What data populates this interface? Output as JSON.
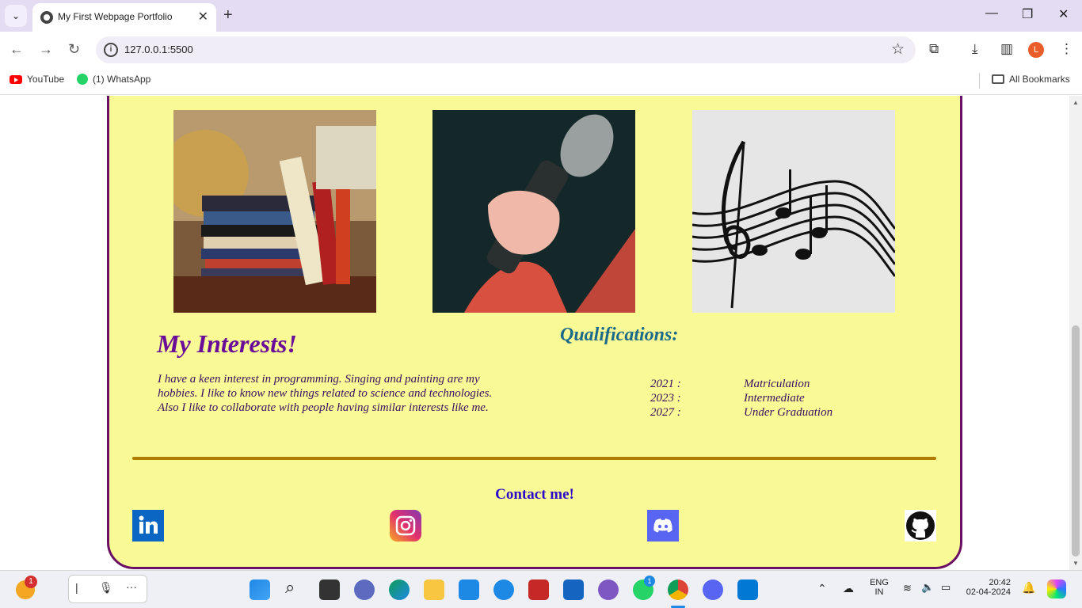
{
  "browser": {
    "tab_title": "My First Webpage Portfolio",
    "new_tab": "+",
    "url": "127.0.0.1:5500",
    "bookmarks": [
      {
        "label": "YouTube",
        "icon": "youtube-icon"
      },
      {
        "label": "(1) WhatsApp",
        "icon": "whatsapp-icon"
      }
    ],
    "all_bookmarks": "All Bookmarks",
    "profile_letter": "L"
  },
  "page": {
    "images": [
      {
        "name": "books-photo",
        "alt": "books"
      },
      {
        "name": "microphone-photo",
        "alt": "microphone"
      },
      {
        "name": "music-notes-photo",
        "alt": "music notes"
      }
    ],
    "interests": {
      "title": "My Interests!",
      "text": "I have a keen interest in programming. Singing and painting are my hobbies. I like to know new things related to science and technologies. Also I like to collaborate with people having similar interests like me."
    },
    "qualifications": {
      "title": "Qualifications:",
      "rows": [
        {
          "year": "2021 :",
          "name": "Matriculation"
        },
        {
          "year": "2023 :",
          "name": "Intermediate"
        },
        {
          "year": "2027 :",
          "name": "Under Graduation"
        }
      ]
    },
    "contact": {
      "title": "Contact me!",
      "links": [
        "linkedin-icon",
        "instagram-icon",
        "discord-icon",
        "github-icon"
      ]
    },
    "colors": {
      "card_bg": "#f9f995",
      "card_border": "#6a1064",
      "interests_title": "#6a0d99",
      "qual_title": "#1c6a8a",
      "contact_title": "#2b0acb",
      "divider": "#b07d00"
    }
  },
  "taskbar": {
    "notification_badge": "1",
    "lang_top": "ENG",
    "lang_bottom": "IN",
    "time": "20:42",
    "date": "02-04-2024",
    "whatsapp_badge": "1"
  }
}
